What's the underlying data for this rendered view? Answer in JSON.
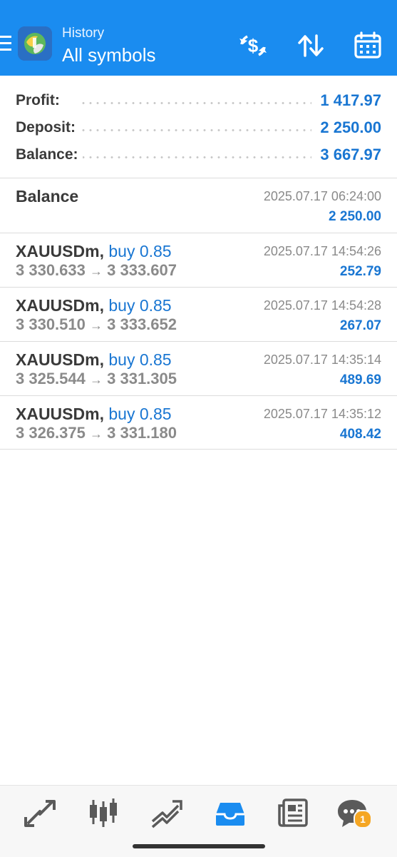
{
  "header": {
    "subtitle": "History",
    "title": "All symbols",
    "background": "#1a8cf0",
    "icons": [
      "menu-icon",
      "metatrader-logo",
      "currency-exchange-icon",
      "sort-icon",
      "calendar-icon"
    ]
  },
  "summary": [
    {
      "label": "Profit:",
      "value": "1 417.97"
    },
    {
      "label": "Deposit:",
      "value": "2 250.00"
    },
    {
      "label": "Balance:",
      "value": "3 667.97"
    }
  ],
  "balance_entry": {
    "title": "Balance",
    "date": "2025.07.17 06:24:00",
    "amount": "2 250.00"
  },
  "deals": [
    {
      "symbol": "XAUUSDm,",
      "type": "buy 0.85",
      "open_price": "3 330.633",
      "arrow": "→",
      "close_price": "3 333.607",
      "date": "2025.07.17 14:54:26",
      "profit": "252.79"
    },
    {
      "symbol": "XAUUSDm,",
      "type": "buy 0.85",
      "open_price": "3 330.510",
      "arrow": "→",
      "close_price": "3 333.652",
      "date": "2025.07.17 14:54:28",
      "profit": "267.07"
    },
    {
      "symbol": "XAUUSDm,",
      "type": "buy 0.85",
      "open_price": "3 325.544",
      "arrow": "→",
      "close_price": "3 331.305",
      "date": "2025.07.17 14:35:14",
      "profit": "489.69"
    },
    {
      "symbol": "XAUUSDm,",
      "type": "buy 0.85",
      "open_price": "3 326.375",
      "arrow": "→",
      "close_price": "3 331.180",
      "date": "2025.07.17 14:35:12",
      "profit": "408.42"
    }
  ],
  "bottom_nav": {
    "items": [
      "quotes-icon",
      "chart-icon",
      "trade-icon",
      "history-icon",
      "news-icon",
      "messages-icon"
    ],
    "active": "history-icon",
    "messages_badge": "1",
    "active_color": "#1a8cf0",
    "inactive_color": "#5a5a5a"
  },
  "colors": {
    "accent": "#1976d2",
    "label": "#3a3a3a",
    "muted": "#8a8a8a",
    "badge": "#f5a623"
  }
}
